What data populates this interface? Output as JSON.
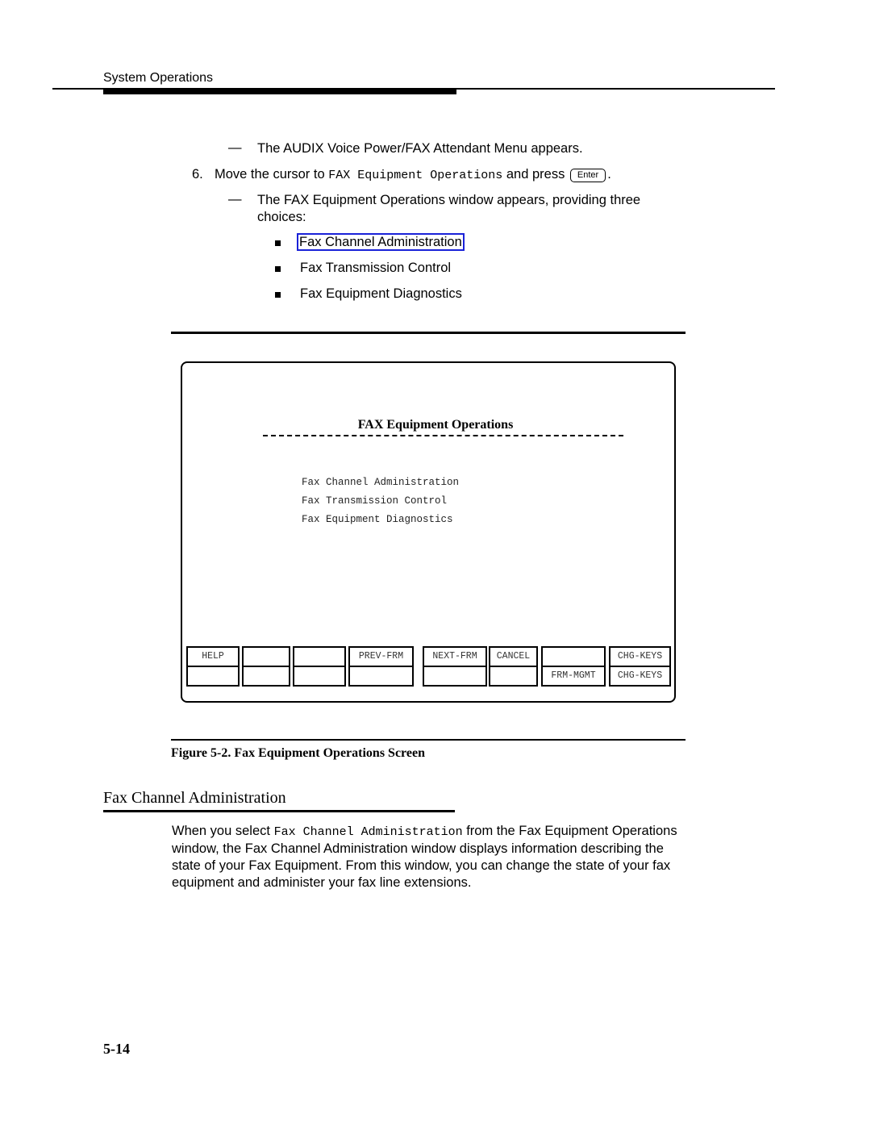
{
  "header": {
    "section_title": "System Operations"
  },
  "steps": {
    "result_1": "The AUDIX Voice Power/FAX Attendant Menu appears.",
    "dash": "—",
    "step_6": {
      "number": "6.",
      "text_before": "Move the cursor to ",
      "code": "FAX Equipment Operations",
      "text_after": " and press ",
      "key": "Enter",
      "end": "."
    },
    "result_2": "The FAX Equipment Operations window appears, providing three choices:",
    "choices": [
      {
        "label": "Fax Channel Administration",
        "is_link": true
      },
      {
        "label": "Fax Transmission Control",
        "is_link": false
      },
      {
        "label": "Fax Equipment Diagnostics",
        "is_link": false
      }
    ]
  },
  "screen": {
    "title": "FAX Equipment Operations",
    "menu_items": [
      "Fax Channel Administration",
      "Fax Transmission Control",
      "Fax Equipment Diagnostics"
    ],
    "function_keys": [
      {
        "top": "HELP",
        "bottom": ""
      },
      {
        "top": "",
        "bottom": ""
      },
      {
        "top": "",
        "bottom": ""
      },
      {
        "top": "PREV-FRM",
        "bottom": ""
      },
      {
        "top": "NEXT-FRM",
        "bottom": ""
      },
      {
        "top": "CANCEL",
        "bottom": ""
      },
      {
        "top": "",
        "bottom": "FRM-MGMT"
      },
      {
        "top": "CHG-KEYS",
        "bottom": "CHG-KEYS"
      }
    ]
  },
  "figure": {
    "caption": "Figure 5-2.  Fax Equipment Operations Screen"
  },
  "section": {
    "title": "Fax Channel Administration",
    "para_before": "When you select ",
    "para_code": "Fax Channel Administration",
    "para_after": " from the Fax Equipment Operations window, the Fax Channel Administration window displays information describing the state of your Fax Equipment.  From this window, you can change the state of your fax equipment and administer your fax line extensions."
  },
  "footer": {
    "page_number": "5-14"
  },
  "colors": {
    "link_outline": "#1a22d8"
  }
}
